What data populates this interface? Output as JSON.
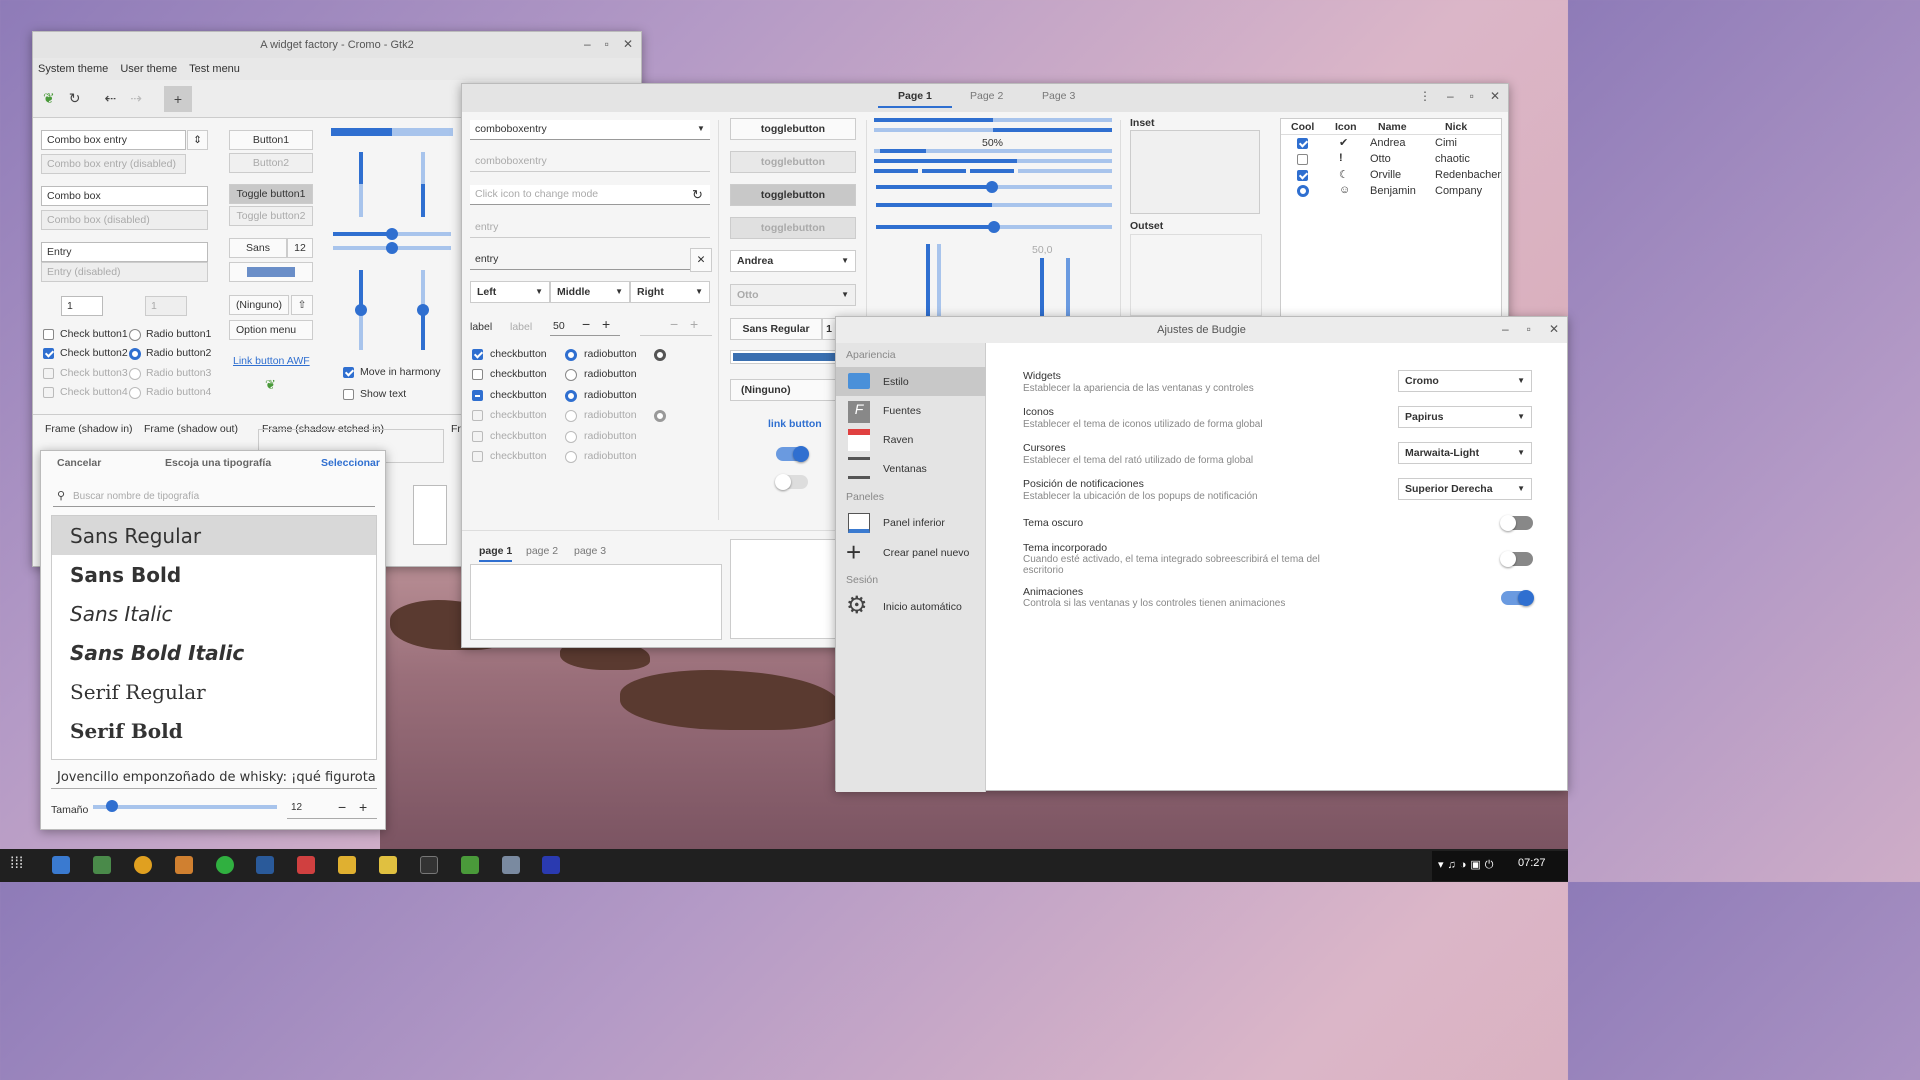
{
  "gtk2": {
    "title": "A widget factory - Cromo - Gtk2",
    "menu": [
      "System theme",
      "User theme",
      "Test menu"
    ],
    "combo_entry": "Combo box entry",
    "combo_entry_dis": "Combo box entry (disabled)",
    "combo": "Combo box",
    "combo_dis": "Combo box (disabled)",
    "entry": "Entry",
    "entry_dis": "Entry (disabled)",
    "spin1": "1",
    "spin2": "1",
    "check1": "Check button1",
    "check2": "Check button2",
    "check3": "Check button3",
    "check4": "Check button4",
    "radio1": "Radio button1",
    "radio2": "Radio button2",
    "radio3": "Radio button3",
    "radio4": "Radio button4",
    "button1": "Button1",
    "button2": "Button2",
    "toggle1": "Toggle button1",
    "toggle2": "Toggle button2",
    "font_name": "Sans",
    "font_size": "12",
    "ninguno": "(Ninguno)",
    "option_menu": "Option menu",
    "link": "Link button AWF",
    "harmony": "Move in harmony",
    "show_text": "Show text",
    "frame1": "Frame (shadow in)",
    "frame2": "Frame (shadow out)",
    "frame3": "Frame (shadow etched in)",
    "frame4": "Fra"
  },
  "fontdlg": {
    "cancel": "Cancelar",
    "title": "Escoja una tipografía",
    "select": "Seleccionar",
    "search": "Buscar nombre de tipografía",
    "fonts": [
      "Sans Regular",
      "Sans Bold",
      "Sans Italic",
      "Sans Bold Italic",
      "Serif Regular",
      "Serif Bold"
    ],
    "preview": "Jovencillo emponzoñado de whisky: ¡qué figurota",
    "size_label": "Tamaño",
    "size": "12"
  },
  "gtk3": {
    "tabs": [
      "Page 1",
      "Page 2",
      "Page 3"
    ],
    "comboentry": "comboboxentry",
    "comboentry_dis": "comboboxentry",
    "icon_entry": "Click icon to change mode",
    "entry_dis": "entry",
    "entry": "entry",
    "left": "Left",
    "middle": "Middle",
    "right": "Right",
    "label": "label",
    "label_dis": "label",
    "spin": "50",
    "check": "checkbutton",
    "radio": "radiobutton",
    "toggle": "togglebutton",
    "andrea": "Andrea",
    "otto": "Otto",
    "font": "Sans Regular",
    "font_size": "1",
    "ninguno": "(Ninguno)",
    "link": "link button",
    "progress_label": "50%",
    "scale_value": "50,0",
    "inset": "Inset",
    "outset": "Outset",
    "nb_tabs": [
      "page 1",
      "page 2",
      "page 3"
    ],
    "tree_headers": [
      "Cool",
      "Icon",
      "Name",
      "Nick"
    ],
    "tree_rows": [
      {
        "name": "Andrea",
        "nick": "Cimi"
      },
      {
        "name": "Otto",
        "nick": "chaotic"
      },
      {
        "name": "Orville",
        "nick": "Redenbacher"
      },
      {
        "name": "Benjamin",
        "nick": "Company"
      }
    ]
  },
  "budgie": {
    "title": "Ajustes de Budgie",
    "sections": [
      "Apariencia",
      "Paneles",
      "Sesión"
    ],
    "nav": [
      "Estilo",
      "Fuentes",
      "Raven",
      "Ventanas",
      "Panel inferior",
      "Crear panel nuevo",
      "Inicio automático"
    ],
    "rows": [
      {
        "title": "Widgets",
        "desc": "Establecer la apariencia de las ventanas y controles",
        "value": "Cromo"
      },
      {
        "title": "Iconos",
        "desc": "Establecer el tema de iconos utilizado de forma global",
        "value": "Papirus"
      },
      {
        "title": "Cursores",
        "desc": "Establecer el tema del rató utilizado de forma global",
        "value": "Marwaita-Light"
      },
      {
        "title": "Posición de notificaciones",
        "desc": "Establecer la ubicación de los popups de notificación",
        "value": "Superior Derecha"
      }
    ],
    "dark": "Tema oscuro",
    "builtin": "Tema incorporado",
    "builtin_desc": "Cuando esté activado, el tema integrado sobreescribirá el tema del escritorio",
    "anim": "Animaciones",
    "anim_desc": "Controla si las ventanas y los controles tienen animaciones"
  },
  "taskbar": {
    "clock": "07:27"
  },
  "colors": {
    "accent": "#2f6fd0"
  }
}
